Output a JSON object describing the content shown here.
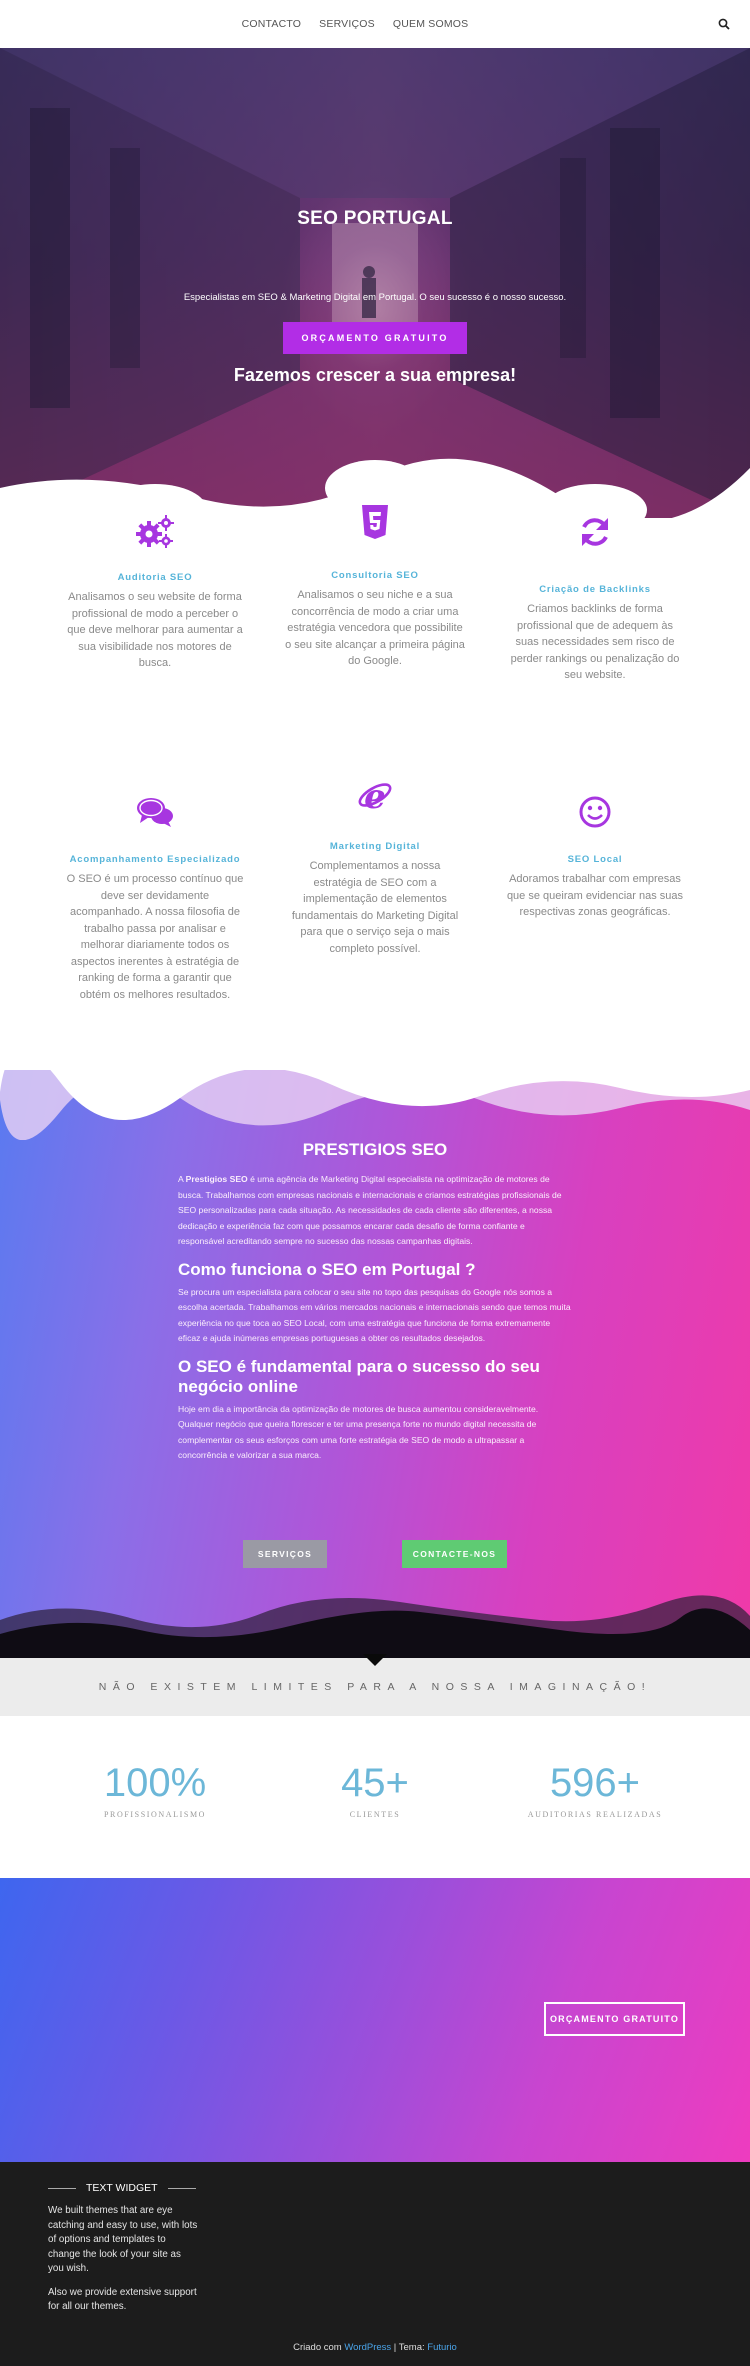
{
  "nav": {
    "items": [
      {
        "label": "CONTACTO"
      },
      {
        "label": "SERVIÇOS"
      },
      {
        "label": "QUEM SOMOS"
      }
    ],
    "search_icon": "search-icon"
  },
  "hero": {
    "title": "SEO PORTUGAL",
    "subtitle": "Especialistas em SEO & Marketing Digital em Portugal. O seu sucesso é o nosso sucesso.",
    "button": "ORÇAMENTO GRATUITO",
    "tagline": "Fazemos crescer a sua empresa!"
  },
  "services": [
    {
      "icon": "gears-icon",
      "title": "Auditoria SEO",
      "desc": "Analisamos o seu website de forma profissional de modo a perceber o que deve melhorar para aumentar a sua visibilidade nos motores de busca."
    },
    {
      "icon": "html5-icon",
      "title": "Consultoria SEO",
      "desc": "Analisamos o seu niche e a sua concorrência de modo a criar uma estratégia vencedora que possibilite o seu site alcançar a primeira página do Google."
    },
    {
      "icon": "refresh-icon",
      "title": "Criação de Backlinks",
      "desc": "Criamos backlinks de forma profissional que de adequem às suas necessidades sem risco de perder rankings ou penalização do seu website."
    },
    {
      "icon": "chat-icon",
      "title": "Acompanhamento Especializado",
      "desc": "O SEO é um processo contínuo que deve ser devidamente acompanhado. A nossa filosofia de trabalho passa por analisar e melhorar diariamente todos os aspectos inerentes à estratégia de ranking de forma a garantir que obtém os melhores resultados."
    },
    {
      "icon": "internet-explorer-icon",
      "title": "Marketing Digital",
      "desc": "Complementamos a nossa estratégia de SEO com a implementação de elementos fundamentais do Marketing Digital para que o serviço seja o mais completo possível."
    },
    {
      "icon": "smile-icon",
      "title": "SEO Local",
      "desc": "Adoramos trabalhar com empresas que se queiram evidenciar nas suas respectivas zonas geográficas."
    }
  ],
  "about": {
    "heading": "PRESTIGIOS SEO",
    "p1_strong": "Prestigios SEO",
    "p1_prefix": "A ",
    "p1_rest": " é uma agência de Marketing Digital especialista na optimização de motores de busca. Trabalhamos com empresas nacionais e internacionais e criamos estratégias profissionais de SEO personalizadas para cada situação. As necessidades de cada cliente são diferentes, a nossa dedicação e experiência faz com que possamos encarar cada desafio de forma confiante e responsável acreditando sempre no sucesso das nossas campanhas digitais.",
    "h2": "Como funciona o SEO em Portugal ?",
    "p2": "Se procura um especialista para colocar o seu site no topo das pesquisas do Google nós somos a escolha acertada. Trabalhamos em vários mercados nacionais e internacionais sendo que temos muita experiência no que toca ao SEO Local, com uma estratégia que funciona de forma extremamente eficaz e ajuda inúmeras empresas portuguesas a obter os resultados desejados.",
    "h3": "O SEO é fundamental para o sucesso do seu negócio online",
    "p3": "Hoje em dia a importância da optimização de motores de busca aumentou consideravelmente. Qualquer negócio que queira florescer e ter uma presença forte no mundo digital necessita de complementar os seus esforços com uma forte estratégia de SEO de modo a ultrapassar a concorrência e valorizar a sua marca.",
    "btn_services": "SERVIÇOS",
    "btn_contact": "CONTACTE-NOS"
  },
  "tagline": "NÃO EXISTEM LIMITES PARA A NOSSA IMAGINAÇÃO!",
  "stats": [
    {
      "number": "100%",
      "label": "PROFISSIONALISMO"
    },
    {
      "number": "45+",
      "label": "CLIENTES"
    },
    {
      "number": "596+",
      "label": "AUDITORIAS REALIZADAS"
    }
  ],
  "cta": {
    "button": "ORÇAMENTO GRATUITO"
  },
  "footer": {
    "widget_title": "TEXT WIDGET",
    "p1": "We built themes that are eye catching and easy to use, with lots of options and templates to change the look of your site as you wish.",
    "p2": "Also we provide extensive support for all our themes.",
    "credit_prefix": "Criado com ",
    "credit_wp": "WordPress",
    "credit_sep": " | Tema: ",
    "credit_theme": "Futurio"
  },
  "colors": {
    "accent": "#b22de6",
    "service_title": "#56b4d9",
    "stat_number": "#6cb7d8",
    "green": "#5fcb73"
  }
}
